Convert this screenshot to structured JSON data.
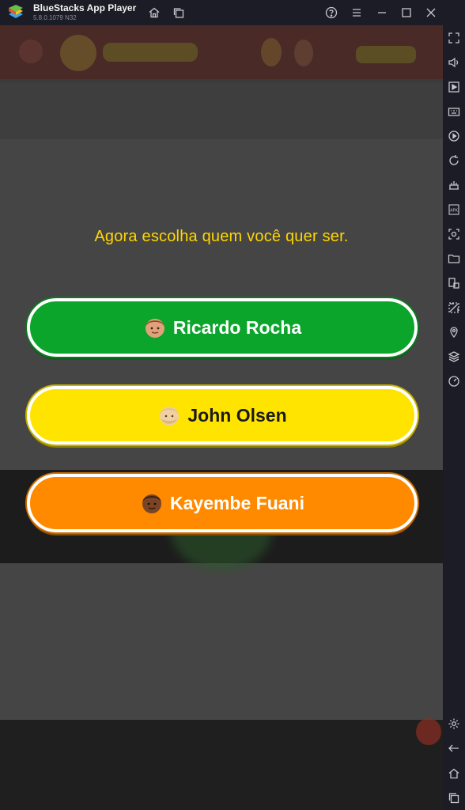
{
  "window": {
    "app_name": "BlueStacks App Player",
    "version": "5.8.0.1079 N32"
  },
  "game": {
    "prompt": "Agora escolha quem você quer ser.",
    "choices": [
      {
        "label": "Ricardo Rocha",
        "color": "#0aa52a",
        "avatar": "brown-hair-man-face"
      },
      {
        "label": "John Olsen",
        "color": "#ffe400",
        "avatar": "blond-man-face"
      },
      {
        "label": "Kayembe Fuani",
        "color": "#ff8a00",
        "avatar": "dark-skin-man-face"
      }
    ]
  },
  "toolbar_icons": [
    "fullscreen-icon",
    "volume-icon",
    "screen-record-icon",
    "keyboard-icon",
    "macro-play-icon",
    "rotate-icon",
    "performance-icon",
    "apk-install-icon",
    "screenshot-icon",
    "folder-icon",
    "multi-instance-icon",
    "eco-mode-icon",
    "location-icon",
    "layers-icon",
    "speedometer-icon",
    "settings-icon",
    "back-icon",
    "home-icon",
    "recents-icon"
  ]
}
